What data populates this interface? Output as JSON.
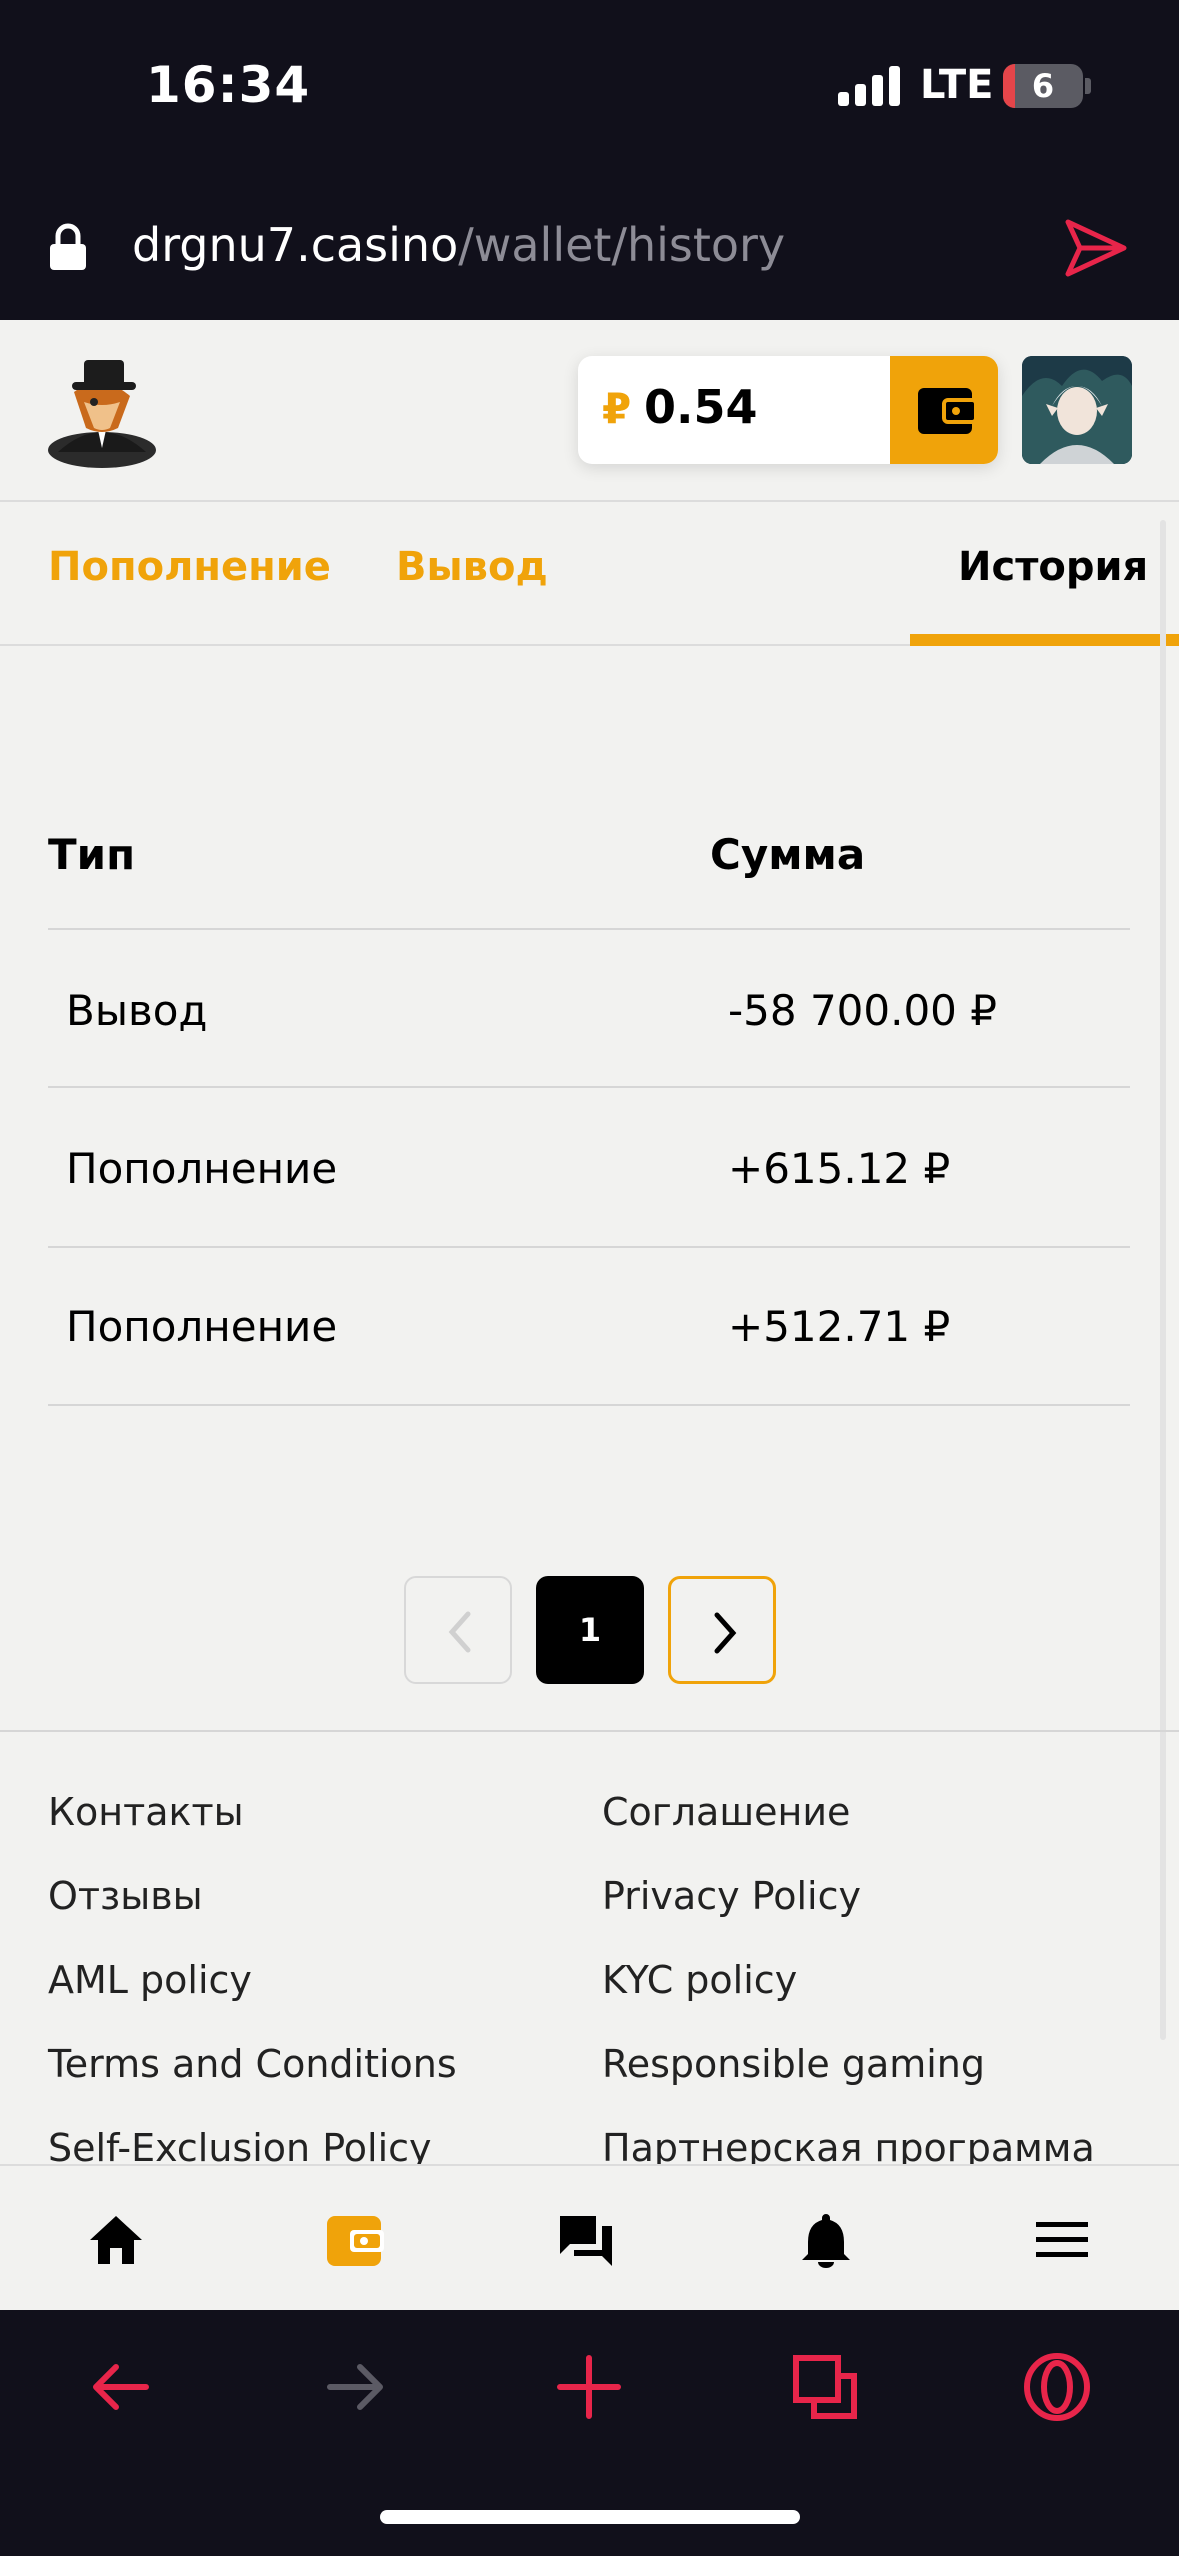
{
  "status_bar": {
    "time": "16:34",
    "network": "LTE",
    "battery": "6"
  },
  "browser": {
    "url_domain": "drgnu7.casino",
    "url_path": "/wallet/history"
  },
  "header": {
    "currency_symbol": "₽",
    "balance": "0.54"
  },
  "tabs": [
    {
      "label": "Пополнение",
      "active": false
    },
    {
      "label": "Вывод",
      "active": false
    },
    {
      "label": "История",
      "active": true
    }
  ],
  "table": {
    "headers": {
      "type": "Тип",
      "sum": "Сумма"
    },
    "rows": [
      {
        "type": "Вывод",
        "sum": "-58 700.00 ₽"
      },
      {
        "type": "Пополнение",
        "sum": "+615.12 ₽"
      },
      {
        "type": "Пополнение",
        "sum": "+512.71 ₽"
      }
    ]
  },
  "pagination": {
    "current_page": "1"
  },
  "footer": {
    "left_links": [
      "Контакты",
      "Отзывы",
      "AML policy",
      "Terms and Conditions",
      "Self-Exclusion Policy"
    ],
    "right_links": [
      "Соглашение",
      "Privacy Policy",
      "KYC policy",
      "Responsible gaming",
      "Партнерская программа"
    ]
  },
  "bottom_nav": [
    "home-icon",
    "wallet-icon",
    "chat-icon",
    "bell-icon",
    "menu-icon"
  ],
  "browser_toolbar": [
    "back-arrow-icon",
    "forward-arrow-icon",
    "new-tab-plus-icon",
    "tabs-icon",
    "opera-icon"
  ],
  "colors": {
    "accent": "#f0a30a",
    "dark_bg": "#11101b",
    "browser_red": "#e8254a",
    "page_bg": "#f2f2f0"
  }
}
